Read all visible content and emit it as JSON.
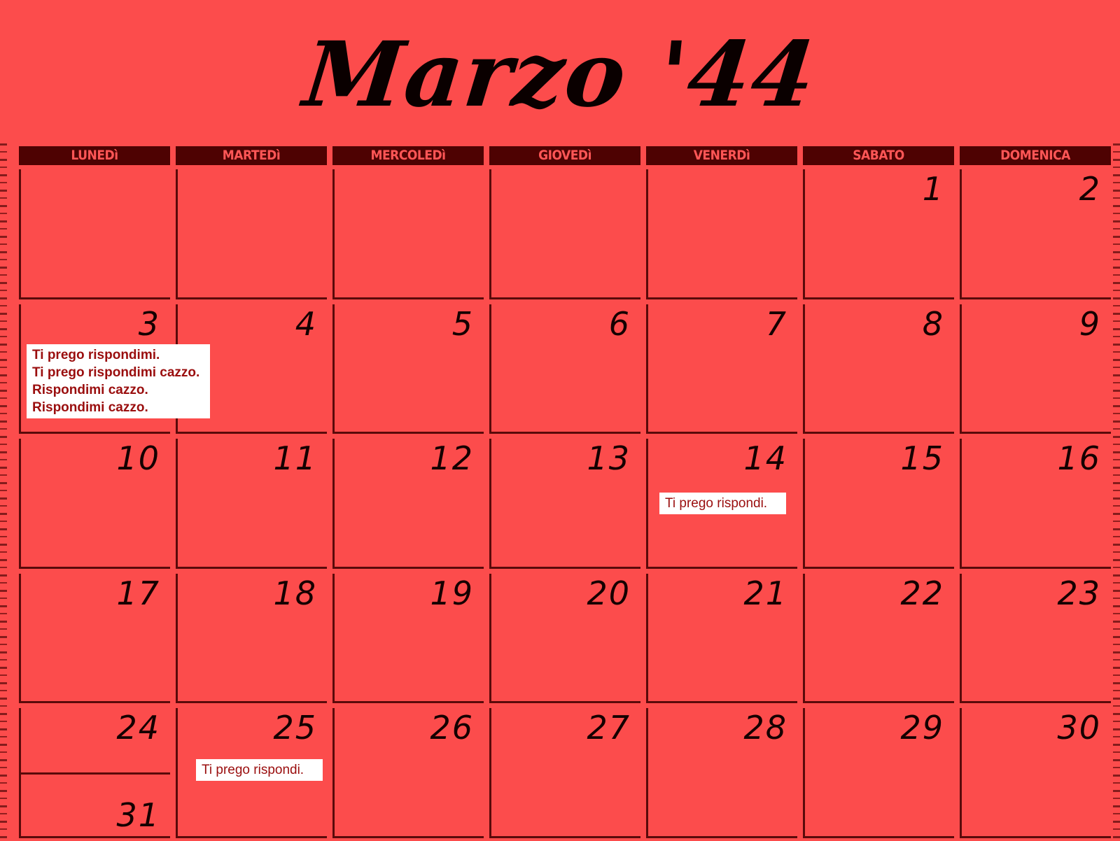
{
  "title": "Marzo '44",
  "weekdays": [
    "LUNEDì",
    "MARTEDì",
    "MERCOLEDì",
    "GIOVEDì",
    "VENERDì",
    "SABATO",
    "DOMENICA"
  ],
  "days": {
    "d1": "1",
    "d2": "2",
    "d3": "3",
    "d4": "4",
    "d5": "5",
    "d6": "6",
    "d7": "7",
    "d8": "8",
    "d9": "9",
    "d10": "10",
    "d11": "11",
    "d12": "12",
    "d13": "13",
    "d14": "14",
    "d15": "15",
    "d16": "16",
    "d17": "17",
    "d18": "18",
    "d19": "19",
    "d20": "20",
    "d21": "21",
    "d22": "22",
    "d23": "23",
    "d24": "24",
    "d25": "25",
    "d26": "26",
    "d27": "27",
    "d28": "28",
    "d29": "29",
    "d30": "30",
    "d31": "31"
  },
  "notes": {
    "march3": [
      "Ti prego rispondimi.",
      "Ti prego rispondimi cazzo.",
      "Rispondimi cazzo.",
      "Rispondimi cazzo."
    ],
    "march14": "Ti prego rispondi.",
    "march25": "Ti prego rispondi."
  },
  "colors": {
    "background": "#fc4c4c",
    "header": "#4e0202",
    "header_text": "#ff5656",
    "note_text": "#9a0e0e"
  }
}
